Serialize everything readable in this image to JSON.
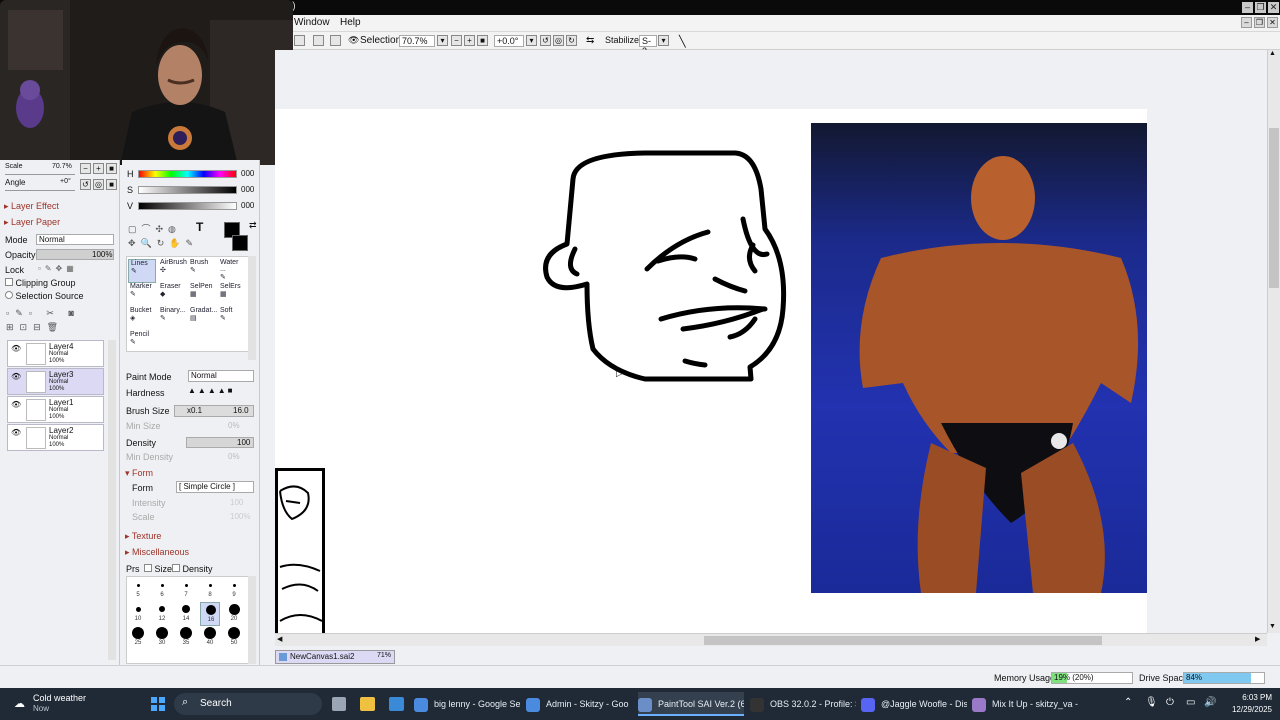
{
  "window": {
    "title_suffix": "(*)"
  },
  "menu": {
    "window": "Window",
    "help": "Help"
  },
  "toolbar": {
    "selection_label": "Selection",
    "zoom": "70.7%",
    "rotation": "+0.0°",
    "stabilizer_label": "Stabilizer",
    "stabilizer_value": "S-2"
  },
  "nav": {
    "scale_label": "Scale",
    "scale_value": "70.7%",
    "angle_label": "Angle",
    "angle_value": "+0°"
  },
  "layer_panel": {
    "layer_effect": "Layer Effect",
    "layer_paper": "Layer Paper",
    "mode_label": "Mode",
    "mode_value": "Normal",
    "opacity_label": "Opacity",
    "opacity_value": "100%",
    "lock_label": "Lock",
    "clipping_group": "Clipping Group",
    "selection_source": "Selection Source",
    "layers": [
      {
        "name": "Layer4",
        "mode": "Normal",
        "opacity": "100%"
      },
      {
        "name": "Layer3",
        "mode": "Normal",
        "opacity": "100%"
      },
      {
        "name": "Layer1",
        "mode": "Normal",
        "opacity": "100%"
      },
      {
        "name": "Layer2",
        "mode": "Normal",
        "opacity": "100%"
      }
    ]
  },
  "color": {
    "h_label": "H",
    "s_label": "S",
    "v_label": "V",
    "h": "000",
    "s": "000",
    "v": "000",
    "primary": "#000000"
  },
  "tools": [
    {
      "name": "Lines"
    },
    {
      "name": "AirBrush"
    },
    {
      "name": "Brush"
    },
    {
      "name": "Water ..."
    },
    {
      "name": "Marker"
    },
    {
      "name": "Eraser"
    },
    {
      "name": "SelPen"
    },
    {
      "name": "SelErs"
    },
    {
      "name": "Bucket"
    },
    {
      "name": "Binary..."
    },
    {
      "name": "Gradat..."
    },
    {
      "name": "Soft"
    },
    {
      "name": "Pencil"
    }
  ],
  "tool_settings": {
    "paint_mode_label": "Paint Mode",
    "paint_mode_value": "Normal",
    "hardness_label": "Hardness",
    "brush_size_label": "Brush Size",
    "brush_size_mult": "x0.1",
    "brush_size_value": "16.0",
    "min_size_label": "Min Size",
    "min_size_value": "0%",
    "density_label": "Density",
    "density_value": "100",
    "min_density_label": "Min Density",
    "min_density_value": "0%",
    "form_header": "Form",
    "form_label": "Form",
    "form_value": "[ Simple Circle ]",
    "intensity_label": "Intensity",
    "intensity_value": "100",
    "scale_label": "Scale",
    "scale_value": "100%",
    "texture": "Texture",
    "misc": "Miscellaneous",
    "prs_label": "Prs",
    "prs_size": "Size",
    "prs_density": "Density"
  },
  "brush_sizes": [
    "5",
    "6",
    "7",
    "8",
    "9",
    "10",
    "12",
    "14",
    "16",
    "20",
    "25",
    "30",
    "35",
    "40",
    "50"
  ],
  "canvas_tab": {
    "name": "NewCanvas1.sai2",
    "zoom": "71%"
  },
  "status": {
    "memory_label": "Memory Usage",
    "memory_value": "19% (20%)",
    "memory_fill": 0.19,
    "drive_label": "Drive Space",
    "drive_value": "84%",
    "drive_fill": 0.84
  },
  "taskbar": {
    "weather_title": "Cold weather",
    "weather_sub": "Now",
    "search": "Search",
    "items": [
      {
        "label": "big lenny - Google Se",
        "color": "#4a8be0"
      },
      {
        "label": "Admin - Skitzy - Goo",
        "color": "#4a8be0"
      },
      {
        "label": "PaintTool SAI Ver.2 (6",
        "color": "#6a8fc8"
      },
      {
        "label": "OBS 32.0.2 - Profile: S",
        "color": "#333333"
      },
      {
        "label": "@Jaggle Woofle - Dis",
        "color": "#5865f2"
      },
      {
        "label": "Mix It Up - skitzy_va -",
        "color": "#9a7ac8"
      }
    ],
    "time": "6:03 PM",
    "date": "12/29/2025"
  }
}
